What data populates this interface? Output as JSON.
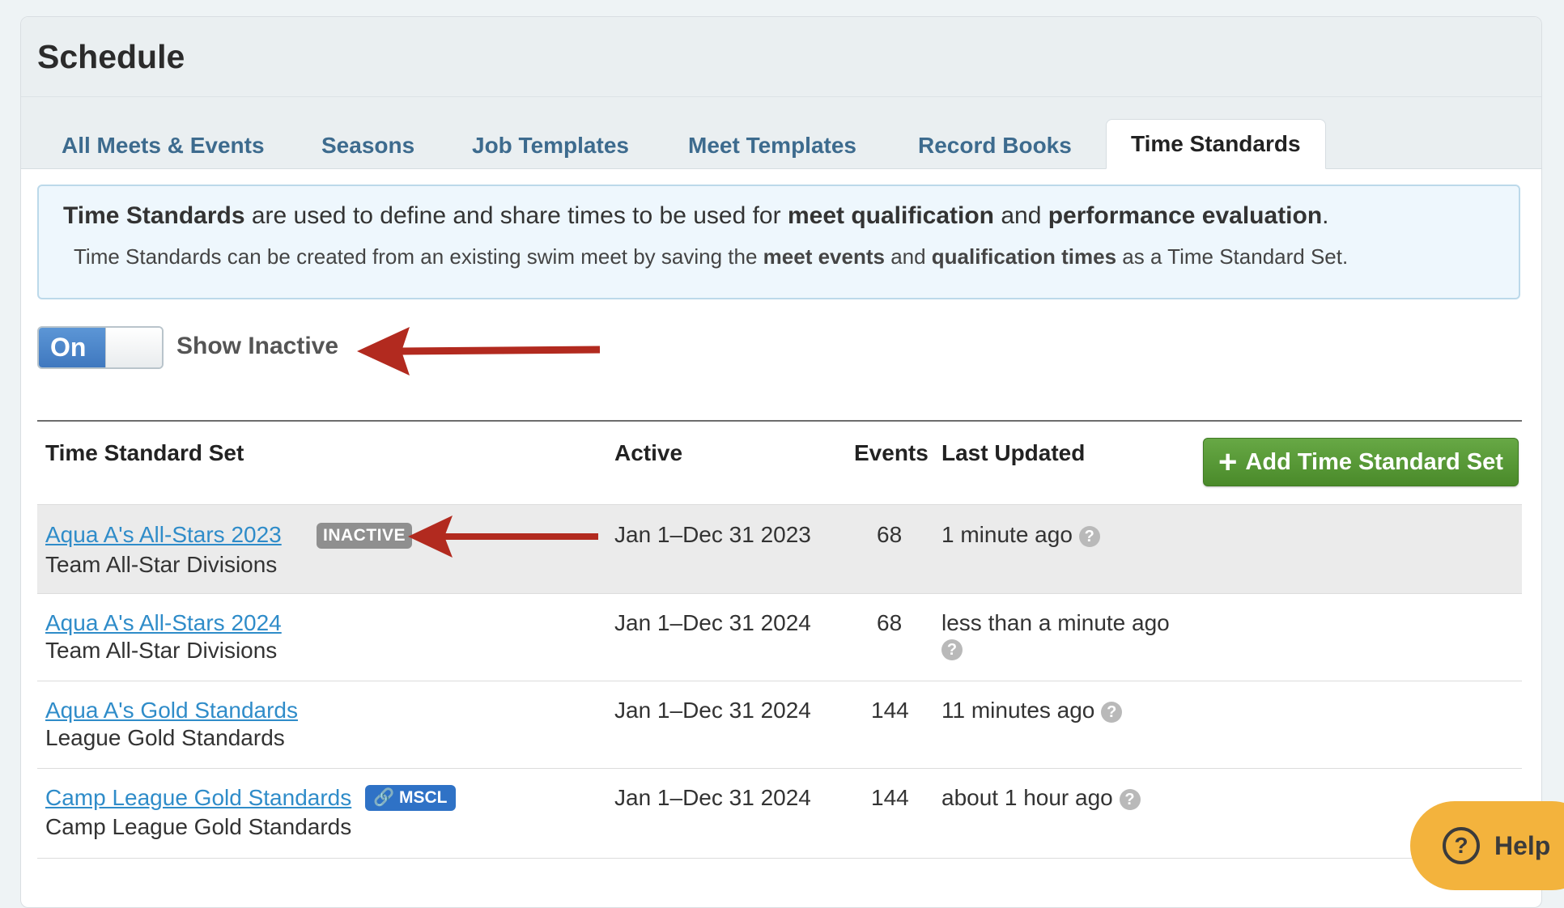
{
  "page": {
    "title": "Schedule"
  },
  "tabs": [
    {
      "label": "All Meets & Events"
    },
    {
      "label": "Seasons"
    },
    {
      "label": "Job Templates"
    },
    {
      "label": "Meet Templates"
    },
    {
      "label": "Record Books"
    },
    {
      "label": "Time Standards",
      "active": true
    }
  ],
  "info": {
    "line1": {
      "b1": "Time Standards",
      "t1": " are used to define and share times to be used for ",
      "b2": "meet qualification",
      "t2": " and ",
      "b3": "performance evaluation",
      "t3": "."
    },
    "line2": {
      "t1": "Time Standards can be created from an existing swim meet by saving the ",
      "b1": "meet events",
      "t2": " and ",
      "b2": "qualification times",
      "t3": " as a Time Standard Set."
    }
  },
  "toggle": {
    "state": "On",
    "label": "Show Inactive"
  },
  "table": {
    "headers": {
      "set": "Time Standard Set",
      "active": "Active",
      "events": "Events",
      "updated": "Last Updated"
    },
    "add_button": "Add Time Standard Set",
    "rows": [
      {
        "name": "Aqua A's All-Stars 2023",
        "sub": "Team All-Star Divisions",
        "badge": "INACTIVE",
        "active": "Jan 1–Dec 31 2023",
        "events": "68",
        "updated": "1 minute ago"
      },
      {
        "name": "Aqua A's All-Stars 2024",
        "sub": "Team All-Star Divisions",
        "active": "Jan 1–Dec 31 2024",
        "events": "68",
        "updated": "less than a minute ago"
      },
      {
        "name": "Aqua A's Gold Standards",
        "sub": "League Gold Standards",
        "active": "Jan 1–Dec 31 2024",
        "events": "144",
        "updated": "11 minutes ago"
      },
      {
        "name": "Camp League Gold Standards",
        "sub": "Camp League Gold Standards",
        "badge": "MSCL",
        "active": "Jan 1–Dec 31 2024",
        "events": "144",
        "updated": "about 1 hour ago"
      }
    ]
  },
  "help": {
    "label": "Help",
    "icon": "?"
  },
  "question_icon": "?",
  "colors": {
    "link": "#2f8cc9",
    "tab": "#3d6b8e",
    "add_button": "#5a9a36",
    "annotation_arrow": "#b22a1f",
    "help": "#f3b33d"
  }
}
